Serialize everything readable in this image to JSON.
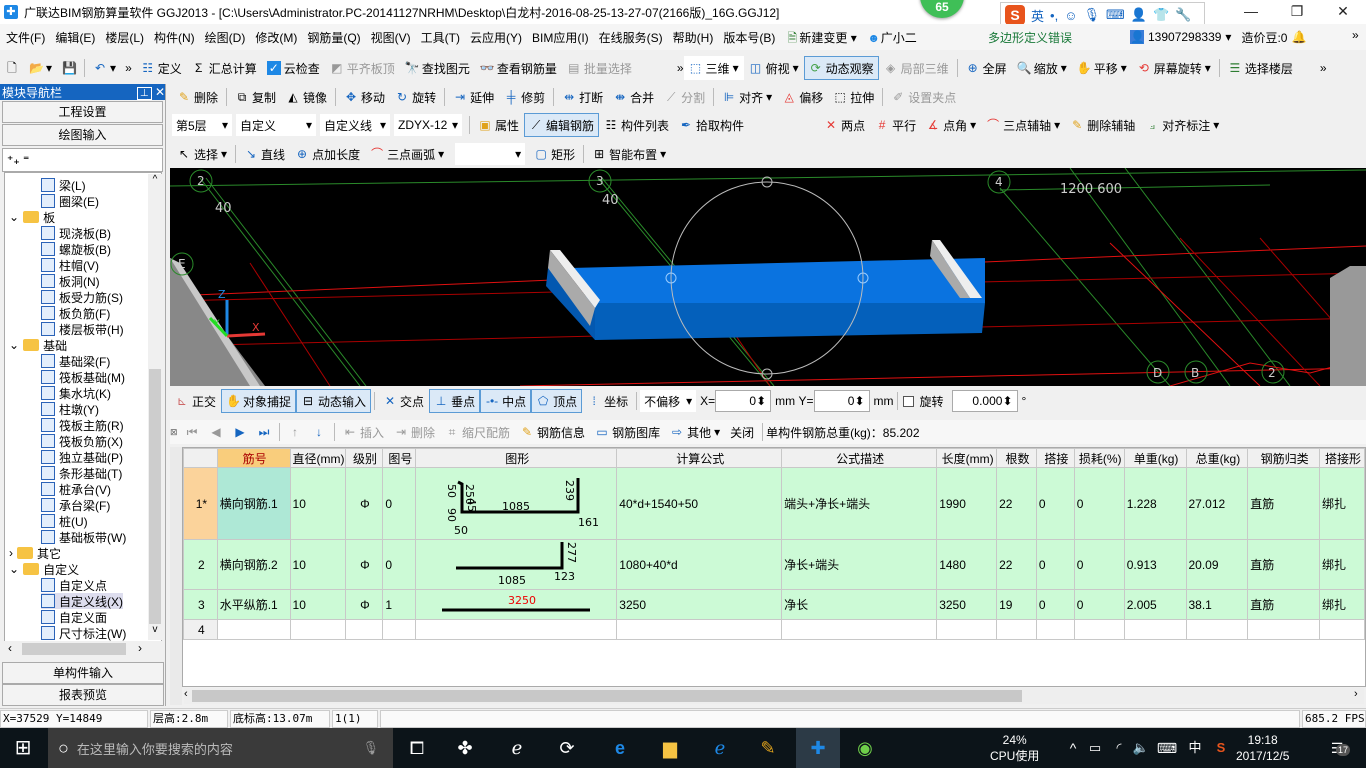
{
  "window": {
    "title": "广联达BIM钢筋算量软件 GGJ2013 - [C:\\Users\\Administrator.PC-20141127NRHM\\Desktop\\白龙村-2016-08-25-13-27-07(2166版)_16G.GGJ12]",
    "badge": "65",
    "ime_lang": "英"
  },
  "menubar": {
    "items": [
      "文件(F)",
      "编辑(E)",
      "楼层(L)",
      "构件(N)",
      "绘图(D)",
      "修改(M)",
      "钢筋量(Q)",
      "视图(V)",
      "工具(T)",
      "云应用(Y)",
      "BIM应用(I)",
      "在线服务(S)",
      "帮助(H)",
      "版本号(B)",
      "新建变更",
      "广小二"
    ],
    "error_text": "多边形定义错误",
    "user_phone": "13907298339",
    "credits": "造价豆:0"
  },
  "toolbar1": {
    "items": [
      "定义",
      "汇总计算",
      "云检查",
      "平齐板顶",
      "查找图元",
      "查看钢筋量",
      "批量选择"
    ],
    "view_items": [
      "三维",
      "俯视",
      "动态观察",
      "局部三维",
      "全屏",
      "缩放",
      "平移",
      "屏幕旋转",
      "选择楼层"
    ]
  },
  "toolbar2": {
    "items": [
      "删除",
      "复制",
      "镜像",
      "移动",
      "旋转",
      "延伸",
      "修剪",
      "打断",
      "合并",
      "分割",
      "对齐",
      "偏移",
      "拉伸",
      "设置夹点"
    ]
  },
  "toolbar3": {
    "floor": "第5层",
    "category": "自定义",
    "type": "自定义线",
    "component": "ZDYX-12",
    "items": [
      "属性",
      "编辑钢筋",
      "构件列表",
      "拾取构件"
    ],
    "axis_items": [
      "两点",
      "平行",
      "点角",
      "三点辅轴",
      "删除辅轴",
      "对齐标注"
    ]
  },
  "toolbar4": {
    "items": [
      "选择",
      "直线",
      "点加长度",
      "三点画弧",
      "矩形",
      "智能布置"
    ]
  },
  "nav": {
    "title": "模块导航栏",
    "buttons": [
      "工程设置",
      "绘图输入"
    ],
    "bottom_buttons": [
      "单构件输入",
      "报表预览"
    ],
    "tree": [
      {
        "label": "梁(L)",
        "level": 2
      },
      {
        "label": "圈梁(E)",
        "level": 2
      },
      {
        "label": "板",
        "level": 1,
        "folder": true
      },
      {
        "label": "现浇板(B)",
        "level": 2
      },
      {
        "label": "螺旋板(B)",
        "level": 2
      },
      {
        "label": "柱帽(V)",
        "level": 2
      },
      {
        "label": "板洞(N)",
        "level": 2
      },
      {
        "label": "板受力筋(S)",
        "level": 2
      },
      {
        "label": "板负筋(F)",
        "level": 2
      },
      {
        "label": "楼层板带(H)",
        "level": 2
      },
      {
        "label": "基础",
        "level": 1,
        "folder": true
      },
      {
        "label": "基础梁(F)",
        "level": 2
      },
      {
        "label": "筏板基础(M)",
        "level": 2
      },
      {
        "label": "集水坑(K)",
        "level": 2
      },
      {
        "label": "柱墩(Y)",
        "level": 2
      },
      {
        "label": "筏板主筋(R)",
        "level": 2
      },
      {
        "label": "筏板负筋(X)",
        "level": 2
      },
      {
        "label": "独立基础(P)",
        "level": 2
      },
      {
        "label": "条形基础(T)",
        "level": 2
      },
      {
        "label": "桩承台(V)",
        "level": 2
      },
      {
        "label": "承台梁(F)",
        "level": 2
      },
      {
        "label": "桩(U)",
        "level": 2
      },
      {
        "label": "基础板带(W)",
        "level": 2
      },
      {
        "label": "其它",
        "level": 1,
        "folder": true
      },
      {
        "label": "自定义",
        "level": 1,
        "folder": true
      },
      {
        "label": "自定义点",
        "level": 2
      },
      {
        "label": "自定义线(X)",
        "level": 2,
        "selected": true
      },
      {
        "label": "自定义面",
        "level": 2
      },
      {
        "label": "尺寸标注(W)",
        "level": 2
      }
    ]
  },
  "viewport": {
    "axis_labels": [
      "2",
      "3",
      "4",
      "E",
      "D",
      "B",
      "2"
    ],
    "dims": [
      "40",
      "40",
      "1200 600"
    ],
    "coord_axes": [
      "Z",
      "Y",
      "X"
    ]
  },
  "snapbar": {
    "items": [
      "正交",
      "对象捕捉",
      "动态输入",
      "交点",
      "垂点",
      "中点",
      "顶点",
      "坐标"
    ],
    "offset_mode": "不偏移",
    "x_label": "X=",
    "x_value": "0",
    "y_label": "Y=",
    "y_value": "0",
    "unit": "mm",
    "rotate_label": "旋转",
    "rotate_value": "0.000",
    "degree": "°"
  },
  "gridbar": {
    "items": [
      "插入",
      "删除",
      "缩尺配筋",
      "钢筋信息",
      "钢筋图库",
      "其他",
      "关闭"
    ],
    "total_weight": "单构件钢筋总重(kg)：85.202"
  },
  "grid": {
    "columns": [
      "",
      "筋号",
      "直径(mm)",
      "级别",
      "图号",
      "图形",
      "计算公式",
      "公式描述",
      "长度(mm)",
      "根数",
      "搭接",
      "损耗(%)",
      "单重(kg)",
      "总重(kg)",
      "钢筋归类",
      "搭接形"
    ],
    "rows": [
      {
        "no": "1*",
        "name": "横向钢筋.1",
        "dia": "10",
        "grade": "Φ",
        "fig": "0",
        "shape_labels": [
          "50",
          "90",
          "250",
          "45",
          "1085",
          "239",
          "161",
          "50"
        ],
        "formula": "40*d+1540+50",
        "desc": "端头+净长+端头",
        "len": "1990",
        "count": "22",
        "lap": "0",
        "loss": "0",
        "unit_w": "1.228",
        "total_w": "27.012",
        "cat": "直筋",
        "lap_type": "绑扎"
      },
      {
        "no": "2",
        "name": "横向钢筋.2",
        "dia": "10",
        "grade": "Φ",
        "fig": "0",
        "shape_labels": [
          "277",
          "1085",
          "123"
        ],
        "formula": "1080+40*d",
        "desc": "净长+端头",
        "len": "1480",
        "count": "22",
        "lap": "0",
        "loss": "0",
        "unit_w": "0.913",
        "total_w": "20.09",
        "cat": "直筋",
        "lap_type": "绑扎"
      },
      {
        "no": "3",
        "name": "水平纵筋.1",
        "dia": "10",
        "grade": "Φ",
        "fig": "1",
        "shape_labels": [
          "3250"
        ],
        "formula": "3250",
        "desc": "净长",
        "len": "3250",
        "count": "19",
        "lap": "0",
        "loss": "0",
        "unit_w": "2.005",
        "total_w": "38.1",
        "cat": "直筋",
        "lap_type": "绑扎"
      },
      {
        "no": "4",
        "name": "",
        "dia": "",
        "grade": "",
        "fig": "",
        "shape_labels": [],
        "formula": "",
        "desc": "",
        "len": "",
        "count": "",
        "lap": "",
        "loss": "",
        "unit_w": "",
        "total_w": "",
        "cat": "",
        "lap_type": ""
      }
    ]
  },
  "statusbar": {
    "coords": "X=37529 Y=14849",
    "floor_height": "层高:2.8m",
    "bottom_elev": "底标高:13.07m",
    "count": "1(1)",
    "fps": "685.2 FPS"
  },
  "taskbar": {
    "search_placeholder": "在这里输入你要搜索的内容",
    "cpu_percent": "24%",
    "cpu_label": "CPU使用",
    "ime": "中",
    "time": "19:18",
    "date": "2017/12/5",
    "notifications": "17"
  },
  "colors": {
    "accent": "#1565c0",
    "grid_row_bg": "#ccfad6",
    "active_header": "#f9cd7c",
    "viewport_bg": "#000000",
    "slab": "#0a73e0"
  }
}
